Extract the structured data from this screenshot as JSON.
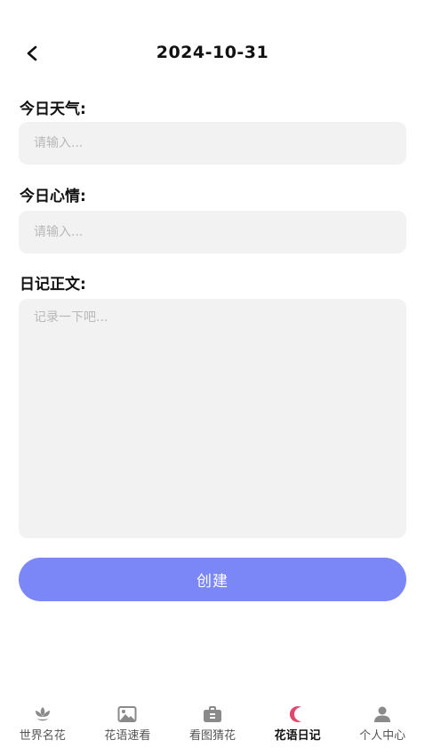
{
  "header": {
    "title": "2024-10-31"
  },
  "form": {
    "weather_label": "今日天气:",
    "weather_placeholder": "请输入...",
    "mood_label": "今日心情:",
    "mood_placeholder": "请输入...",
    "body_label": "日记正文:",
    "body_placeholder": "记录一下吧..."
  },
  "actions": {
    "create_label": "创建"
  },
  "tabbar": {
    "items": [
      {
        "label": "世界名花",
        "icon": "flower-icon"
      },
      {
        "label": "花语速看",
        "icon": "image-icon"
      },
      {
        "label": "看图猜花",
        "icon": "briefcase-icon"
      },
      {
        "label": "花语日记",
        "icon": "moon-icon"
      },
      {
        "label": "个人中心",
        "icon": "person-icon"
      }
    ],
    "active_index": 3
  },
  "colors": {
    "accent": "#7b86f7",
    "active_tab": "#e0476a",
    "field_bg": "#f2f2f2",
    "inactive_icon": "#8a8a8a"
  }
}
